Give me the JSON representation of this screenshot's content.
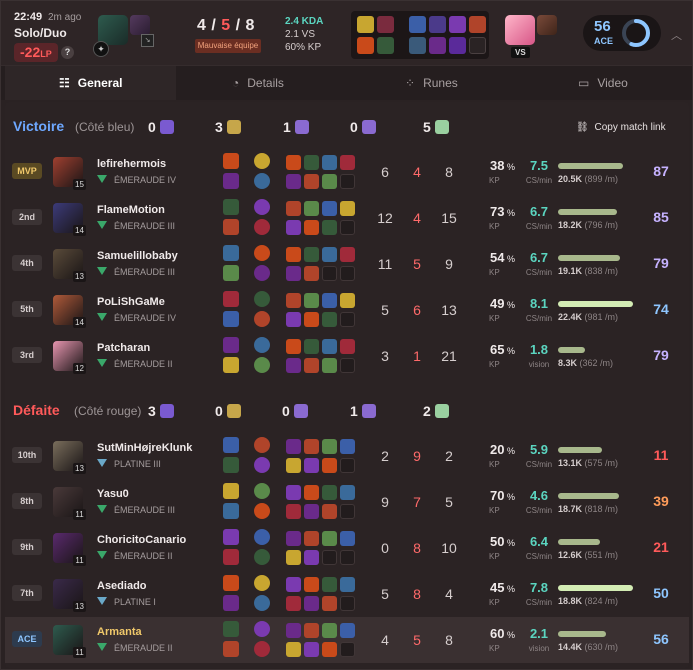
{
  "header": {
    "time": "22:49",
    "ago": "2m ago",
    "queue": "Solo/Duo",
    "lp_value": "-22",
    "lp_unit": "LP",
    "help_label": "?",
    "kda_k": "4",
    "kda_d": "5",
    "kda_a": "8",
    "badge": "Mauvaise équipe",
    "kda_ratio": "2.4 KDA",
    "vs_ratio": "2.1 VS",
    "kp": "60% KP",
    "vs_label": "VS",
    "ace_score": "56",
    "ace_label": "ACE",
    "ace_fraction": 0.56
  },
  "tabs": [
    {
      "label": "General",
      "icon": "grid-list-icon"
    },
    {
      "label": "Details",
      "icon": "clock-pie-icon"
    },
    {
      "label": "Runes",
      "icon": "dots-grid-icon"
    },
    {
      "label": "Video",
      "icon": "video-camera-icon"
    }
  ],
  "copy_link": "Copy match link",
  "teams": [
    {
      "result": "Victoire",
      "side": "(Côté bleu)",
      "color": "#6ea8ff",
      "baron": "0",
      "dragon": "3",
      "herald": "1",
      "voidgrubs": "0",
      "towers": "5",
      "players": [
        {
          "rank": "MVP",
          "name": "lefirehermois",
          "level": "15",
          "tier": "ÉMERAUDE IV",
          "k": "6",
          "d": "4",
          "a": "8",
          "kp": "38",
          "cs": "7.5",
          "cs_label": "CS/min",
          "dmg": "20.5K",
          "dmg_min": "(899 /m)",
          "dmg_frac": 0.62,
          "score": "87",
          "score_color": "#c6b2ff",
          "av": "#a04030"
        },
        {
          "rank": "2nd",
          "name": "FlameMotion",
          "level": "14",
          "tier": "ÉMERAUDE III",
          "k": "12",
          "d": "4",
          "a": "15",
          "kp": "73",
          "cs": "6.7",
          "cs_label": "CS/min",
          "dmg": "18.2K",
          "dmg_min": "(796 /m)",
          "dmg_frac": 0.56,
          "score": "85",
          "score_color": "#c6b2ff",
          "av": "#3c3b7a"
        },
        {
          "rank": "4th",
          "name": "Samuelillobaby",
          "level": "13",
          "tier": "ÉMERAUDE III",
          "k": "11",
          "d": "5",
          "a": "9",
          "kp": "54",
          "cs": "6.7",
          "cs_label": "CS/min",
          "dmg": "19.1K",
          "dmg_min": "(838 /m)",
          "dmg_frac": 0.59,
          "score": "79",
          "score_color": "#c6b2ff",
          "av": "#5a4b3a"
        },
        {
          "rank": "5th",
          "name": "PoLiShGaMe",
          "level": "14",
          "tier": "ÉMERAUDE IV",
          "k": "5",
          "d": "6",
          "a": "13",
          "kp": "49",
          "cs": "8.1",
          "cs_label": "CS/min",
          "dmg": "22.4K",
          "dmg_min": "(981 /m)",
          "dmg_frac": 0.71,
          "score": "74",
          "score_color": "#8ec6ff",
          "av": "#b05a3a"
        },
        {
          "rank": "3rd",
          "name": "Patcharan",
          "level": "12",
          "tier": "ÉMERAUDE II",
          "k": "3",
          "d": "1",
          "a": "21",
          "kp": "65",
          "cs": "1.8",
          "cs_label": "vision",
          "dmg": "8.3K",
          "dmg_min": "(362 /m)",
          "dmg_frac": 0.26,
          "score": "79",
          "score_color": "#c6b2ff",
          "av": "#e796b0"
        }
      ]
    },
    {
      "result": "Défaite",
      "side": "(Côté rouge)",
      "color": "#ff5a5a",
      "baron": "3",
      "dragon": "0",
      "herald": "0",
      "voidgrubs": "1",
      "towers": "2",
      "players": [
        {
          "rank": "10th",
          "name": "SutMinHøjreKlunk",
          "level": "13",
          "tier": "PLATINE III",
          "k": "2",
          "d": "9",
          "a": "2",
          "kp": "20",
          "cs": "5.9",
          "cs_label": "CS/min",
          "dmg": "13.1K",
          "dmg_min": "(575 /m)",
          "dmg_frac": 0.42,
          "score": "11",
          "score_color": "#ff5a5a",
          "av": "#7a6e5c"
        },
        {
          "rank": "8th",
          "name": "Yasu0",
          "level": "11",
          "tier": "ÉMERAUDE III",
          "k": "9",
          "d": "7",
          "a": "5",
          "kp": "70",
          "cs": "4.6",
          "cs_label": "CS/min",
          "dmg": "18.7K",
          "dmg_min": "(818 /m)",
          "dmg_frac": 0.58,
          "score": "39",
          "score_color": "#ff9c5a",
          "av": "#4a3a3a"
        },
        {
          "rank": "9th",
          "name": "ChoricitoCanario",
          "level": "11",
          "tier": "ÉMERAUDE II",
          "k": "0",
          "d": "8",
          "a": "10",
          "kp": "50",
          "cs": "6.4",
          "cs_label": "CS/min",
          "dmg": "12.6K",
          "dmg_min": "(551 /m)",
          "dmg_frac": 0.4,
          "score": "21",
          "score_color": "#ff5a5a",
          "av": "#5a2a6e"
        },
        {
          "rank": "7th",
          "name": "Asediado",
          "level": "13",
          "tier": "PLATINE I",
          "k": "5",
          "d": "8",
          "a": "4",
          "kp": "45",
          "cs": "7.8",
          "cs_label": "CS/min",
          "dmg": "18.8K",
          "dmg_min": "(824 /m)",
          "dmg_frac": 0.71,
          "score": "50",
          "score_color": "#8ec6ff",
          "av": "#3a2a4a"
        },
        {
          "rank": "ACE",
          "name": "Armanta",
          "level": "11",
          "tier": "ÉMERAUDE II",
          "k": "4",
          "d": "5",
          "a": "8",
          "kp": "60",
          "cs": "2.1",
          "cs_label": "vision",
          "dmg": "14.4K",
          "dmg_min": "(630 /m)",
          "dmg_frac": 0.46,
          "score": "56",
          "score_color": "#8ec6ff",
          "av": "#2e5b4e",
          "self": true
        }
      ]
    }
  ]
}
